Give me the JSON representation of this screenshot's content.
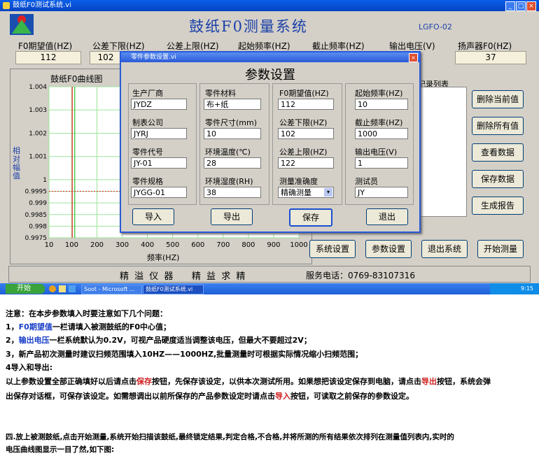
{
  "window": {
    "title": "鼓纸F0测试系统.vi",
    "controls": [
      "_",
      "□",
      "×"
    ]
  },
  "header": {
    "app_title": "鼓纸F0测量系统",
    "code": "LGFO-02"
  },
  "params": [
    {
      "label": "F0期望值(HZ)",
      "value": "112"
    },
    {
      "label": "公差下限(HZ)",
      "value": "102"
    },
    {
      "label": "公差上限(HZ)",
      "value": ""
    },
    {
      "label": "起始频率(HZ)",
      "value": ""
    },
    {
      "label": "截止频率(HZ)",
      "value": ""
    },
    {
      "label": "输出电压(V)",
      "value": ""
    },
    {
      "label": "扬声器F0(HZ)",
      "value": "37"
    }
  ],
  "chart_data": {
    "type": "line",
    "title": "鼓纸F0曲线图",
    "xlabel": "频率(HZ)",
    "ylabel": "相对幅值",
    "x_ticks": [
      "10",
      "100",
      "200",
      "300",
      "400",
      "500",
      "600",
      "700",
      "800",
      "900",
      "1000"
    ],
    "y_ticks": [
      "1.004",
      "1.003",
      "1.002",
      "1.001",
      "1",
      "0.9995",
      "0.999",
      "0.9985",
      "0.998",
      "0.9975"
    ],
    "xlim": [
      10,
      1000
    ],
    "ylim": [
      0.9975,
      1.004
    ],
    "grid": true,
    "vlines": [
      {
        "x": 102,
        "color": "#e02020"
      },
      {
        "x": 112,
        "color": "#2ec02e"
      }
    ],
    "hline": {
      "y": 0.9995,
      "color": "#e02020"
    },
    "series": []
  },
  "record_list": {
    "label": "记录列表"
  },
  "side_buttons": [
    "删除当前值",
    "删除所有值",
    "查看数据",
    "保存数据",
    "生成报告"
  ],
  "bottom_buttons": [
    "系统设置",
    "参数设置",
    "退出系统",
    "开始测量"
  ],
  "footer": {
    "company": "精 溢 仪 器    精 益 求 精",
    "phone": "服务电话：0769-83107316"
  },
  "taskbar": {
    "start": "开始",
    "items": [
      "Soot - Microsoft ...",
      "鼓纸F0测试系统.vi"
    ],
    "time": "9:15"
  },
  "dialog": {
    "title": "零件参数设置.vi",
    "heading": "参数设置",
    "fields": [
      {
        "label": "生产厂商",
        "value": "JYDZ"
      },
      {
        "label": "零件材料",
        "value": "布+纸"
      },
      {
        "label": "F0期望值(HZ)",
        "value": "112"
      },
      {
        "label": "起始频率(HZ)",
        "value": "10"
      },
      {
        "label": "制表公司",
        "value": "JYRJ"
      },
      {
        "label": "零件尺寸(mm)",
        "value": "10"
      },
      {
        "label": "公差下限(HZ)",
        "value": "102"
      },
      {
        "label": "截止频率(HZ)",
        "value": "1000"
      },
      {
        "label": "零件代号",
        "value": "JY-01"
      },
      {
        "label": "环境温度(℃)",
        "value": "28"
      },
      {
        "label": "公差上限(HZ)",
        "value": "122"
      },
      {
        "label": "输出电压(V)",
        "value": "1"
      },
      {
        "label": "零件规格",
        "value": "JYGG-01"
      },
      {
        "label": "环境湿度(RH)",
        "value": "38"
      },
      {
        "label": "测量准确度",
        "value": "精确测量"
      },
      {
        "label": "测试员",
        "value": "JY"
      }
    ],
    "buttons": [
      "导入",
      "导出",
      "保存",
      "退出"
    ]
  },
  "notes": {
    "intro": "注意：在本步参数填入时要注意如下几个问题：",
    "n1_a": "1，",
    "n1_hl": "F0期望值",
    "n1_b": "一栏请填入被测鼓纸的F0中心值；",
    "n2_a": "2，",
    "n2_hl": "输出电压",
    "n2_b": "一栏系统默认为0.2V，可视产品硬度适当调整该电压，但最大不要超过2V；",
    "n3": "3，新产品初次测量时建议扫频范围填入10HZ——1000HZ,批量测量时可根据实际情况缩小扫频范围；",
    "n4": "4导入和导出:",
    "p1_a": "以上参数设置全部正确填好以后请点击",
    "p1_hl1": "保存",
    "p1_b": "按钮，先保存该设定，以供本次测试所用。如果想把该设定保存到电脑，请点击",
    "p1_hl2": "导出",
    "p1_c": "按钮，系统会弹",
    "p2_a": "出保存对话框，可保存该设定。如需想调出以前所保存的产品参数设定时请点击",
    "p2_hl": "导入",
    "p2_b": "按钮，可读取之前保存的参数设定。",
    "s4_1": "四.放上被测鼓纸,点击开始测量,系统开始扫描该鼓纸,最终锁定结果,判定合格,不合格,并将所测的所有结果依次排列在测量值列表内,实时的",
    "s4_2": "电压曲线图显示一目了然,如下图:"
  }
}
